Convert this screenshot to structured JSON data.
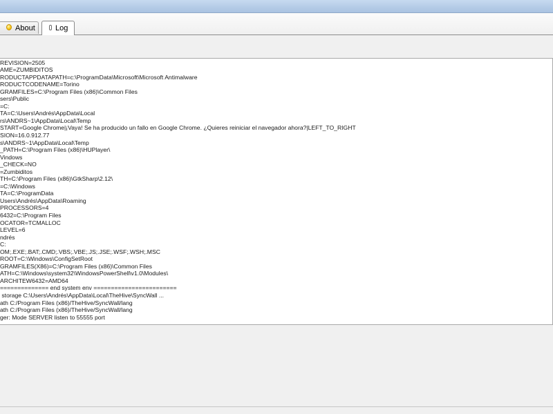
{
  "tabs": [
    {
      "label": "About",
      "icon": "lightbulb-icon"
    },
    {
      "label": "Log",
      "icon": "paperclip-icon"
    }
  ],
  "log": {
    "lines": [
      "REVISION=2505",
      "AME=ZUMBIDITOS",
      "RODUCTAPPDATAPATH=c:\\ProgramData\\Microsoft\\Microsoft Antimalware",
      "RODUCTCODENAME=Torino",
      "GRAMFILES=C:\\Program Files (x86)\\Common Files",
      "sers\\Public",
      "=C:",
      "TA=C:\\Users\\Andrés\\AppData\\Local",
      "rs\\ANDRS~1\\AppData\\Local\\Temp",
      "START=Google Chrome|¡Vaya! Se ha producido un fallo en Google Chrome. ¿Quieres reiniciar el navegador ahora?|LEFT_TO_RIGHT",
      "SION=16.0.912.77",
      "s\\ANDRS~1\\AppData\\Local\\Temp",
      "_PATH=C:\\Program Files (x86)\\HUPlayer\\",
      "Vindows",
      "_CHECK=NO",
      "=Zumbiditos",
      "TH=C:\\Program Files (x86)\\GtkSharp\\2.12\\",
      "=C:\\Windows",
      "TA=C:\\ProgramData",
      "Users\\Andrés\\AppData\\Roaming",
      "PROCESSORS=4",
      "6432=C:\\Program Files",
      "OCATOR=TCMALLOC",
      "LEVEL=6",
      "ndrés",
      "C:",
      "OM;.EXE;.BAT;.CMD;.VBS;.VBE;.JS;.JSE;.WSF;.WSH;.MSC",
      "ROOT=C:\\Windows\\ConfigSetRoot",
      "GRAMFILES(X86)=C:\\Program Files (x86)\\Common Files",
      "ATH=C:\\Windows\\system32\\WindowsPowerShell\\v1.0\\Modules\\",
      "ARCHITEW6432=AMD64",
      "============== end system env ========================",
      " storage C:\\Users\\Andrés\\AppData\\Local\\TheHive\\SyncWall ...",
      "ath C:/Program Files (x86)/TheHive/SyncWall/lang",
      "ath C:/Program Files (x86)/TheHive/SyncWall/lang",
      "ger: Mode SERVER listen to 55555 port"
    ]
  }
}
